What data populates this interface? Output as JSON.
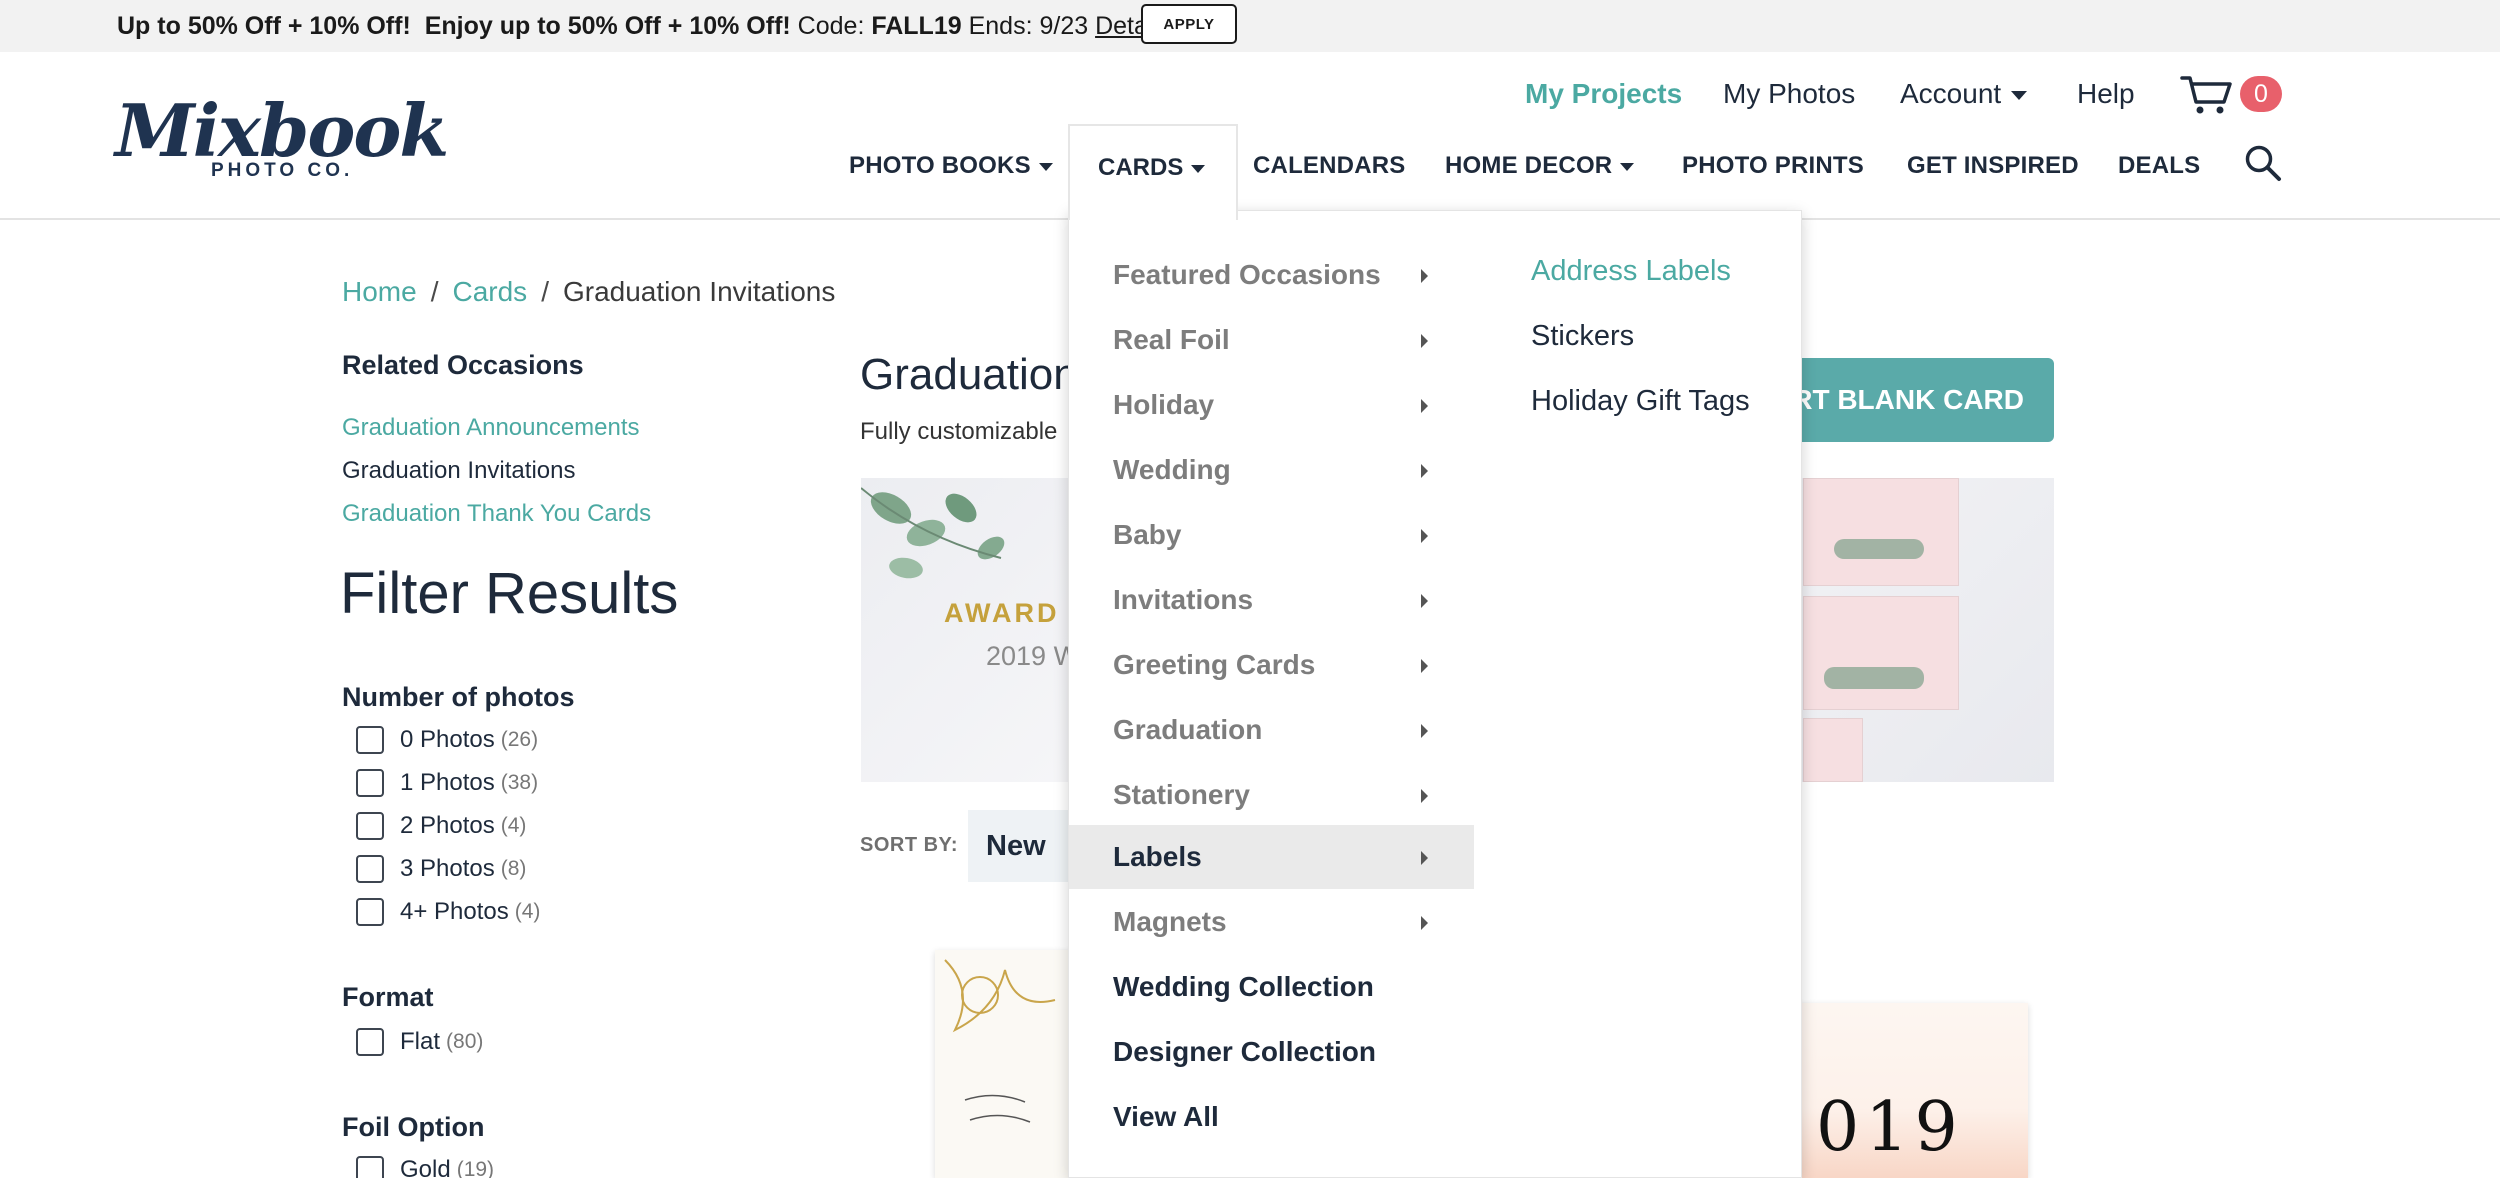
{
  "promo": {
    "part1_bold": "Up to 50% Off + 10% Off!",
    "part2_bold": "Enjoy up to 50% Off + 10% Off!",
    "code_label": "Code:",
    "code": "FALL19",
    "ends": "Ends: 9/23",
    "details_link": "Details",
    "apply_button": "APPLY"
  },
  "logo": {
    "main": "Mixbook",
    "sub": "PHOTO CO."
  },
  "utility_nav": {
    "my_projects": "My Projects",
    "my_photos": "My Photos",
    "account": "Account",
    "help": "Help",
    "cart_count": "0"
  },
  "main_nav": {
    "photo_books": "PHOTO BOOKS",
    "cards": "CARDS",
    "calendars": "CALENDARS",
    "home_decor": "HOME DECOR",
    "photo_prints": "PHOTO PRINTS",
    "get_inspired": "GET INSPIRED",
    "deals": "DEALS"
  },
  "breadcrumb": {
    "home": "Home",
    "cards": "Cards",
    "current": "Graduation Invitations",
    "separator": "/"
  },
  "sidebar": {
    "related_heading": "Related Occasions",
    "related": [
      {
        "label": "Graduation Announcements"
      },
      {
        "label": "Graduation Invitations"
      },
      {
        "label": "Graduation Thank You Cards"
      }
    ],
    "filter_title": "Filter Results",
    "groups": [
      {
        "heading": "Number of photos",
        "options": [
          {
            "label": "0 Photos",
            "count": "(26)"
          },
          {
            "label": "1 Photos",
            "count": "(38)"
          },
          {
            "label": "2 Photos",
            "count": "(4)"
          },
          {
            "label": "3 Photos",
            "count": "(8)"
          },
          {
            "label": "4+ Photos",
            "count": "(4)"
          }
        ]
      },
      {
        "heading": "Format",
        "options": [
          {
            "label": "Flat",
            "count": "(80)"
          }
        ]
      },
      {
        "heading": "Foil Option",
        "options": [
          {
            "label": "Gold",
            "count": "(19)"
          }
        ]
      }
    ]
  },
  "main": {
    "title_visible": "Graduation",
    "subtitle_visible": "Fully customizable",
    "start_button_visible": "RT BLANK CARD",
    "banner_award": "AWARD W",
    "banner_year": "2019 W",
    "sort_label": "SORT BY:",
    "sort_value": "New",
    "product_year": "019"
  },
  "dropdown": {
    "items": [
      {
        "label": "Featured Occasions",
        "has_submenu": true
      },
      {
        "label": "Real Foil",
        "has_submenu": true
      },
      {
        "label": "Holiday",
        "has_submenu": true
      },
      {
        "label": "Wedding",
        "has_submenu": true
      },
      {
        "label": "Baby",
        "has_submenu": true
      },
      {
        "label": "Invitations",
        "has_submenu": true
      },
      {
        "label": "Greeting Cards",
        "has_submenu": true
      },
      {
        "label": "Graduation",
        "has_submenu": true
      },
      {
        "label": "Stationery",
        "has_submenu": true
      },
      {
        "label": "Labels",
        "has_submenu": true,
        "active": true
      },
      {
        "label": "Magnets",
        "has_submenu": true
      },
      {
        "label": "Wedding Collection",
        "has_submenu": false
      },
      {
        "label": "Designer Collection",
        "has_submenu": false
      },
      {
        "label": "View All",
        "has_submenu": false
      }
    ],
    "submenu": [
      {
        "label": "Address Labels"
      },
      {
        "label": "Stickers"
      },
      {
        "label": "Holiday Gift Tags"
      }
    ]
  },
  "colors": {
    "accent_teal": "#4ba9a2",
    "navy": "#1e2a3b",
    "cart_badge": "#e8606b",
    "promo_bg": "#f2f2f2"
  }
}
